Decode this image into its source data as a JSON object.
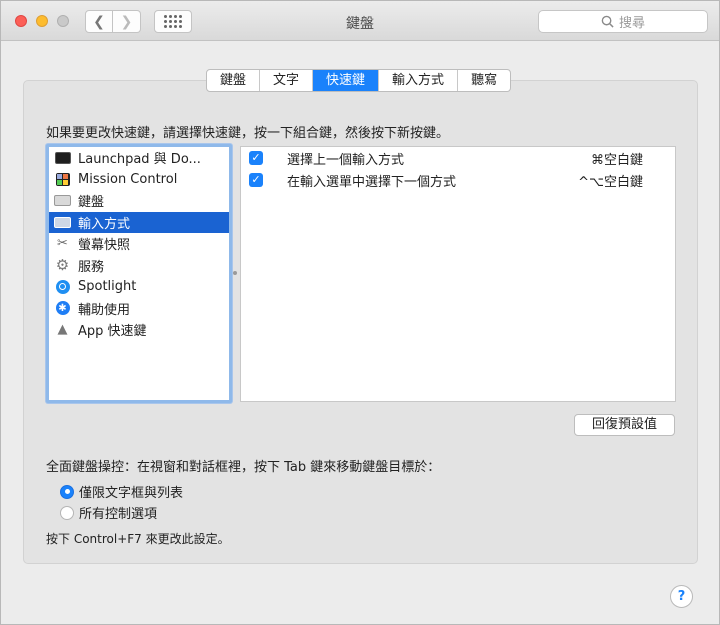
{
  "window": {
    "title": "鍵盤"
  },
  "search": {
    "placeholder": "搜尋"
  },
  "tabs": [
    {
      "label": "鍵盤"
    },
    {
      "label": "文字"
    },
    {
      "label": "快速鍵",
      "active": true
    },
    {
      "label": "輸入方式"
    },
    {
      "label": "聽寫"
    }
  ],
  "instruction": "如果要更改快速鍵，請選擇快速鍵，按一下組合鍵，然後按下新按鍵。",
  "categories": [
    {
      "label": "Launchpad 與 Do...",
      "icon": "launchpad-icon"
    },
    {
      "label": "Mission Control",
      "icon": "mission-control-icon"
    },
    {
      "label": "鍵盤",
      "icon": "keyboard-icon"
    },
    {
      "label": "輸入方式",
      "icon": "keyboard-icon",
      "selected": true
    },
    {
      "label": "螢幕快照",
      "icon": "screenshot-icon"
    },
    {
      "label": "服務",
      "icon": "gear-icon"
    },
    {
      "label": "Spotlight",
      "icon": "spotlight-icon"
    },
    {
      "label": "輔助使用",
      "icon": "accessibility-icon"
    },
    {
      "label": "App 快速鍵",
      "icon": "app-shortcuts-icon"
    }
  ],
  "shortcuts": [
    {
      "checked": true,
      "label": "選擇上一個輸入方式",
      "key": "⌘空白鍵"
    },
    {
      "checked": true,
      "label": "在輸入選單中選擇下一個方式",
      "key": "^⌥空白鍵"
    }
  ],
  "restore_button": "回復預設值",
  "full_keyboard": {
    "label": "全面鍵盤操控：在視窗和對話框裡，按下 Tab 鍵來移動鍵盤目標於：",
    "options": [
      {
        "label": "僅限文字框與列表",
        "selected": true
      },
      {
        "label": "所有控制選項",
        "selected": false
      }
    ],
    "hint": "按下 Control+F7 來更改此設定。"
  },
  "help": "?"
}
